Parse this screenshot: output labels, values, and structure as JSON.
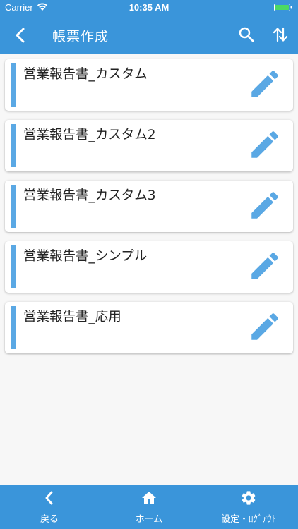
{
  "status": {
    "carrier": "Carrier",
    "time": "10:35 AM"
  },
  "header": {
    "title": "帳票作成"
  },
  "reports": [
    {
      "label": "営業報告書_カスタム"
    },
    {
      "label": "営業報告書_カスタム2"
    },
    {
      "label": "営業報告書_カスタム3"
    },
    {
      "label": "営業報告書_シンプル"
    },
    {
      "label": "営業報告書_応用"
    }
  ],
  "tabs": {
    "back_label": "戻る",
    "home_label": "ホーム",
    "settings_label": "設定・ﾛｸﾞｱｳﾄ"
  },
  "colors": {
    "primary": "#3a95da",
    "accent": "#5aa8e4"
  },
  "icons": [
    "chevron-left-icon",
    "search-icon",
    "sort-icon",
    "pencil-icon",
    "home-icon",
    "gear-icon"
  ]
}
